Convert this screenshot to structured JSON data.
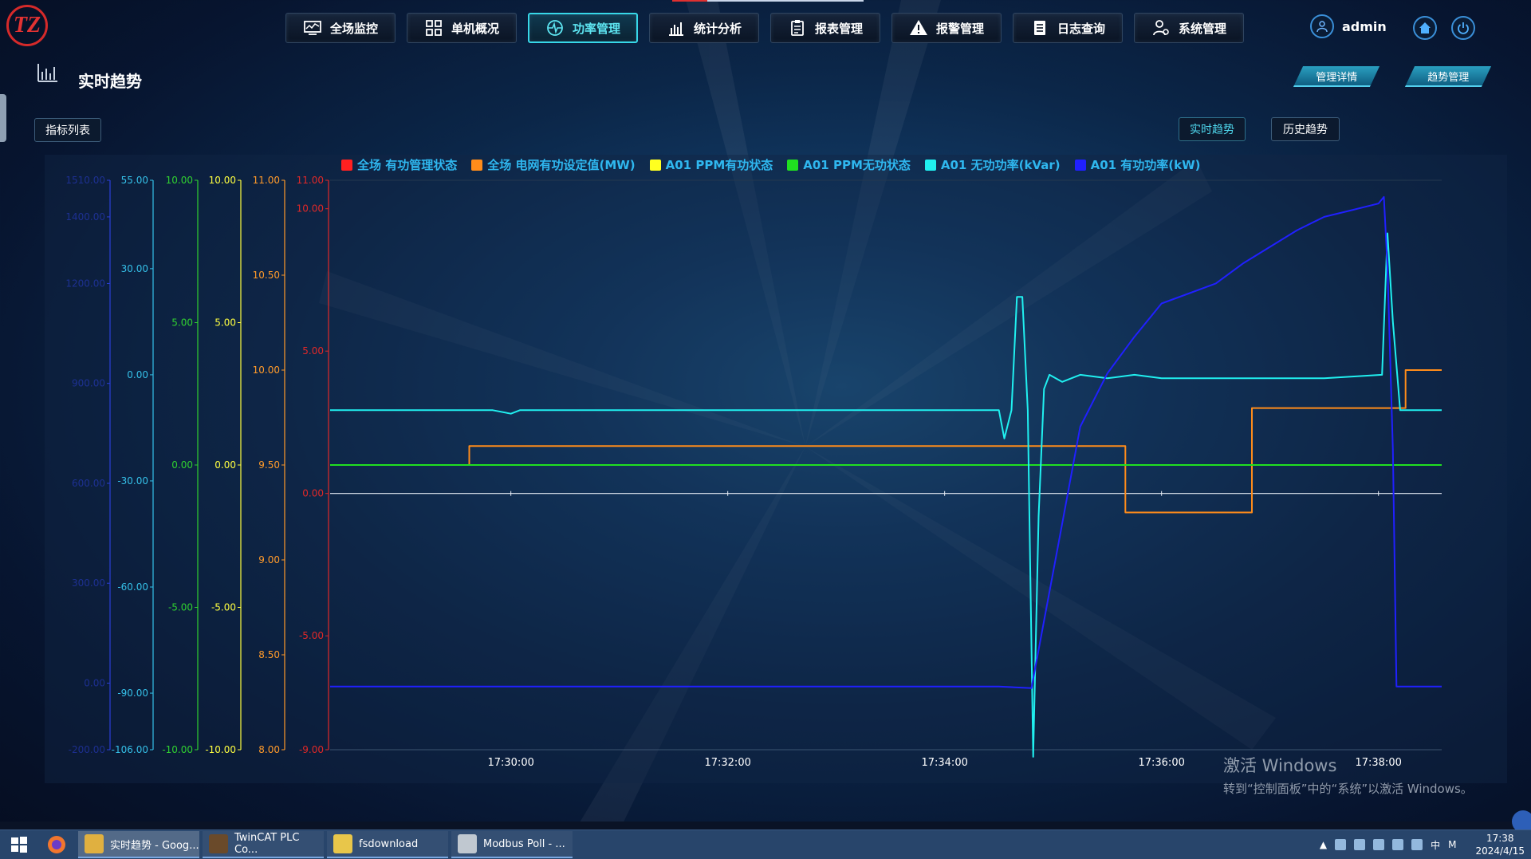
{
  "app": {
    "logo_text": "TZ",
    "user": "admin"
  },
  "nav": [
    {
      "label": "全场监控",
      "icon": "monitor-icon"
    },
    {
      "label": "单机概况",
      "icon": "grid-icon"
    },
    {
      "label": "功率管理",
      "icon": "power-wave-icon",
      "active": true
    },
    {
      "label": "统计分析",
      "icon": "bar-chart-icon"
    },
    {
      "label": "报表管理",
      "icon": "clipboard-icon"
    },
    {
      "label": "报警管理",
      "icon": "warning-icon"
    },
    {
      "label": "日志查询",
      "icon": "log-icon"
    },
    {
      "label": "系统管理",
      "icon": "settings-people-icon"
    }
  ],
  "page": {
    "title": "实时趋势",
    "manage_detail": "管理详情",
    "trend_manage": "趋势管理",
    "indicator_list": "指标列表",
    "realtime_trend": "实时趋势",
    "history_trend": "历史趋势"
  },
  "watermark": {
    "line1": "激活 Windows",
    "line2": "转到“控制面板”中的“系统”以激活 Windows。"
  },
  "taskbar": {
    "tasks": [
      {
        "label": "实时趋势 - Goog...",
        "color": "#e0b040"
      },
      {
        "label": "TwinCAT PLC Co...",
        "color": "#6a4a2a"
      },
      {
        "label": "fsdownload",
        "color": "#e8c64a"
      },
      {
        "label": "Modbus Poll - ...",
        "color": "#c0c8d0"
      }
    ],
    "time": "17:38",
    "date": "2024/4/15"
  },
  "chart_data": {
    "type": "line",
    "legend": [
      {
        "name": "全场 有功管理状态",
        "color": "#ff2020"
      },
      {
        "name": "全场 电网有功设定值(MW)",
        "color": "#ff8c1a"
      },
      {
        "name": "A01 PPM有功状态",
        "color": "#ffff20"
      },
      {
        "name": "A01 PPM无功状态",
        "color": "#20e020"
      },
      {
        "name": "A01 无功功率(kVar)",
        "color": "#20f0f0"
      },
      {
        "name": "A01 有功功率(kW)",
        "color": "#2020ff"
      }
    ],
    "x_ticks": [
      "17:30:00",
      "17:32:00",
      "17:34:00",
      "17:36:00",
      "17:38:00"
    ],
    "x_range": [
      "17:28:20",
      "17:38:35"
    ],
    "y_axes": [
      {
        "color": "#2b3fd8",
        "ticks": [
          "1510.00",
          "1400.00",
          "1200.00",
          "900.00",
          "600.00",
          "300.00",
          "0.00",
          "-200.00"
        ],
        "range": [
          -200,
          1510
        ]
      },
      {
        "color": "#35c0e8",
        "ticks": [
          "55.00",
          "30.00",
          "0.00",
          "-30.00",
          "-60.00",
          "-90.00",
          "-106.00"
        ],
        "range": [
          -106,
          55
        ]
      },
      {
        "color": "#30d030",
        "ticks": [
          "10.00",
          "5.00",
          "0.00",
          "-5.00",
          "-10.00"
        ],
        "range": [
          -10,
          10
        ]
      },
      {
        "color": "#ffff40",
        "ticks": [
          "10.00",
          "5.00",
          "0.00",
          "-5.00",
          "-10.00"
        ],
        "range": [
          -10,
          10
        ]
      },
      {
        "color": "#ff9a2a",
        "ticks": [
          "11.00",
          "10.50",
          "10.00",
          "9.50",
          "9.00",
          "8.50",
          "8.00"
        ],
        "range": [
          8,
          11
        ]
      },
      {
        "color": "#e02828",
        "ticks": [
          "11.00",
          "10.00",
          "5.00",
          "0.00",
          "-5.00",
          "-9.00"
        ],
        "range": [
          -9,
          11
        ]
      }
    ],
    "series": [
      {
        "name": "全场 电网有功设定值(MW)",
        "color": "#ff8c1a",
        "points": [
          [
            "17:28:20",
            9.5
          ],
          [
            "17:29:37",
            9.5
          ],
          [
            "17:29:37",
            9.6
          ],
          [
            "17:35:40",
            9.6
          ],
          [
            "17:35:40",
            9.25
          ],
          [
            "17:36:50",
            9.25
          ],
          [
            "17:36:50",
            9.8
          ],
          [
            "17:38:15",
            9.8
          ],
          [
            "17:38:15",
            10.0
          ],
          [
            "17:38:35",
            10.0
          ]
        ]
      },
      {
        "name": "A01 PPM无功状态",
        "color": "#20e020",
        "points": [
          [
            "17:28:20",
            0
          ],
          [
            "17:38:35",
            0
          ]
        ]
      },
      {
        "name": "A01 无功功率(kVar)",
        "color": "#20f0f0",
        "points": [
          [
            "17:28:20",
            -10
          ],
          [
            "17:29:50",
            -10
          ],
          [
            "17:30:00",
            -11
          ],
          [
            "17:30:05",
            -10
          ],
          [
            "17:34:30",
            -10
          ],
          [
            "17:34:33",
            -18
          ],
          [
            "17:34:37",
            -10
          ],
          [
            "17:34:40",
            22
          ],
          [
            "17:34:43",
            22
          ],
          [
            "17:34:46",
            -10
          ],
          [
            "17:34:49",
            -108
          ],
          [
            "17:34:52",
            -40
          ],
          [
            "17:34:55",
            -4
          ],
          [
            "17:34:58",
            0
          ],
          [
            "17:35:05",
            -2
          ],
          [
            "17:35:15",
            0
          ],
          [
            "17:35:30",
            -1
          ],
          [
            "17:35:45",
            0
          ],
          [
            "17:36:00",
            -1
          ],
          [
            "17:36:30",
            -1
          ],
          [
            "17:37:00",
            -1
          ],
          [
            "17:37:30",
            -1
          ],
          [
            "17:38:02",
            0
          ],
          [
            "17:38:05",
            40
          ],
          [
            "17:38:08",
            15
          ],
          [
            "17:38:12",
            -10
          ],
          [
            "17:38:20",
            -10
          ],
          [
            "17:38:35",
            -10
          ]
        ]
      },
      {
        "name": "A01 有功功率(kW)",
        "color": "#2020ff",
        "points": [
          [
            "17:28:20",
            -10
          ],
          [
            "17:30:00",
            -10
          ],
          [
            "17:34:30",
            -10
          ],
          [
            "17:34:48",
            -15
          ],
          [
            "17:35:03",
            420
          ],
          [
            "17:35:15",
            770
          ],
          [
            "17:35:30",
            930
          ],
          [
            "17:35:45",
            1040
          ],
          [
            "17:36:00",
            1140
          ],
          [
            "17:36:15",
            1170
          ],
          [
            "17:36:30",
            1200
          ],
          [
            "17:36:45",
            1260
          ],
          [
            "17:37:00",
            1310
          ],
          [
            "17:37:15",
            1360
          ],
          [
            "17:37:30",
            1400
          ],
          [
            "17:37:45",
            1420
          ],
          [
            "17:38:00",
            1440
          ],
          [
            "17:38:03",
            1460
          ],
          [
            "17:38:05",
            1250
          ],
          [
            "17:38:08",
            700
          ],
          [
            "17:38:10",
            -10
          ],
          [
            "17:38:35",
            -10
          ]
        ]
      }
    ]
  }
}
